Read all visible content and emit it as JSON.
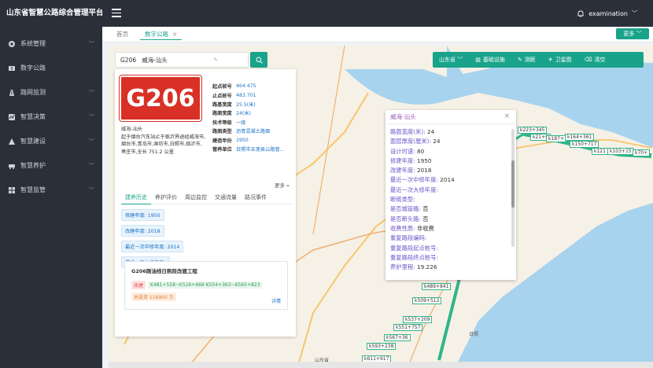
{
  "app": {
    "title": "山东省智慧公路综合管理平台"
  },
  "sidebar": {
    "items": [
      {
        "label": "系统管理"
      },
      {
        "label": "数字公路"
      },
      {
        "label": "路网监测"
      },
      {
        "label": "智慧决策"
      },
      {
        "label": "智慧建设"
      },
      {
        "label": "智慧养护"
      },
      {
        "label": "智慧监管"
      }
    ]
  },
  "header": {
    "user": "examination"
  },
  "tabs": {
    "home": "首页",
    "current": "数字公路",
    "close": "×",
    "more": "更多"
  },
  "search": {
    "value": "G206   威海-汕头",
    "clear": "✎"
  },
  "toolbar": {
    "region": "山东省",
    "basic": "基础设施",
    "measure": "测距",
    "satellite": "卫星图",
    "clear": "清空"
  },
  "road": {
    "code": "G206",
    "name": "威海-汕头",
    "desc": "起于烟台汽车站止于临沂界途经威海市,烟台市,青岛市,潍坊市,日照市,临沂市,枣庄市,全长 751.2 公里",
    "attrs": [
      {
        "k": "起点桩号",
        "v": "464.475"
      },
      {
        "k": "止点桩号",
        "v": "483.701"
      },
      {
        "k": "路基宽度",
        "v": "25.5(米)"
      },
      {
        "k": "路面宽度",
        "v": "24(米)"
      },
      {
        "k": "技术等级",
        "v": "一级"
      },
      {
        "k": "路面类型",
        "v": "沥青混凝土路面"
      },
      {
        "k": "建造年份",
        "v": "1950"
      },
      {
        "k": "管养单位",
        "v": "日照市五莲县公路管..."
      }
    ],
    "more": "更多 »"
  },
  "panel_tabs": [
    "建养历史",
    "养护评价",
    "周边监控",
    "交通流量",
    "路况事件"
  ],
  "history": [
    "修建年度: 1950",
    "改建年度: 2018",
    "最近一次中修年度: 2014",
    "最近一次大修年度:"
  ],
  "project": {
    "title": "G206刚油线日照段改建工程",
    "type": "改建",
    "range": "K481+558~K526+666 K554+363~K565+823",
    "amount": "总投资 116900 万",
    "detail": "详情"
  },
  "popup": {
    "title": "威海-汕头",
    "close": "×",
    "lines": [
      {
        "k": "路面宽度(米): ",
        "v": "24"
      },
      {
        "k": "面层厚度(厘米): ",
        "v": "24"
      },
      {
        "k": "设计时速: ",
        "v": "80"
      },
      {
        "k": "修建年度: ",
        "v": "1950"
      },
      {
        "k": "改建年度: ",
        "v": "2018"
      },
      {
        "k": "最近一次中修年度: ",
        "v": "2014"
      },
      {
        "k": "最近一次大修年度: ",
        "v": ""
      },
      {
        "k": "断链类型: ",
        "v": ""
      },
      {
        "k": "是否城管路: ",
        "v": "否"
      },
      {
        "k": "是否断头路: ",
        "v": "否"
      },
      {
        "k": "收费性质: ",
        "v": "非收费"
      },
      {
        "k": "重复路段编码: ",
        "v": ""
      },
      {
        "k": "重复路段起点桩号: ",
        "v": ""
      },
      {
        "k": "重复路段终点桩号: ",
        "v": ""
      },
      {
        "k": "养护里程: ",
        "v": "19.226"
      }
    ]
  },
  "km_labels": [
    "k223+345",
    "k21+6",
    "k187+",
    "k164+361",
    "k150+717",
    "k121",
    "k103+15",
    "k70+",
    "k489+841",
    "k509+512",
    "k537+209",
    "k551+757",
    "k567+36",
    "k593+238",
    "k611+917"
  ],
  "cities": [
    "山东省",
    "日照"
  ],
  "colors": {
    "accent": "#1aa38b",
    "sidebar": "#2b2f3a",
    "shield": "#d93025"
  }
}
